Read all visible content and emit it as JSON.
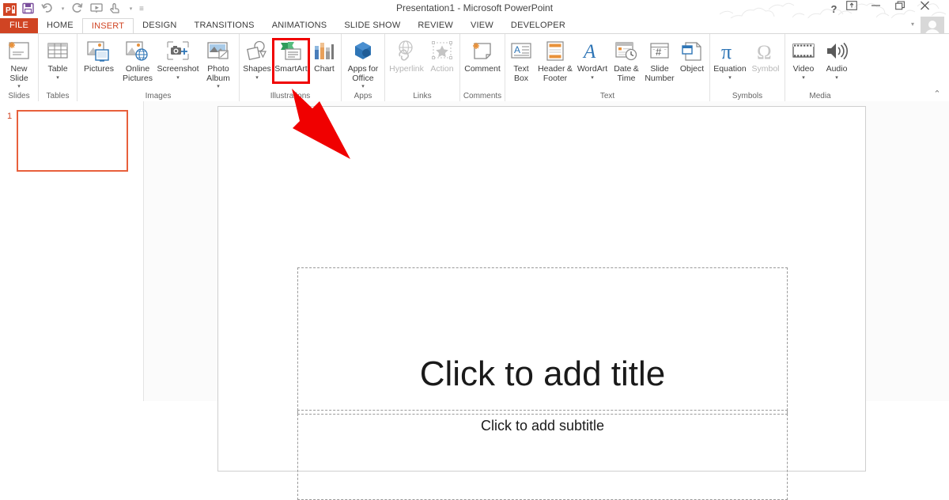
{
  "window": {
    "title": "Presentation1 - Microsoft PowerPoint",
    "logo_text": "P",
    "controls": {
      "help": "?",
      "ribbon_display": "ribbon-display-options",
      "minimize": "minimize",
      "restore": "restore",
      "close": "close"
    }
  },
  "quick_access": {
    "items": [
      {
        "name": "save-icon",
        "glyph": "💾"
      },
      {
        "name": "undo-icon",
        "glyph": "↶"
      },
      {
        "name": "redo-icon",
        "glyph": "↻"
      },
      {
        "name": "start-presentation-icon",
        "glyph": "▷"
      },
      {
        "name": "touch-mode-icon",
        "glyph": "☝"
      }
    ],
    "more_glyph": "≡",
    "caret_glyph": "▾"
  },
  "tabs": {
    "file": "FILE",
    "items": [
      {
        "label": "HOME",
        "active": false
      },
      {
        "label": "INSERT",
        "active": true
      },
      {
        "label": "DESIGN",
        "active": false
      },
      {
        "label": "TRANSITIONS",
        "active": false
      },
      {
        "label": "ANIMATIONS",
        "active": false
      },
      {
        "label": "SLIDE SHOW",
        "active": false
      },
      {
        "label": "REVIEW",
        "active": false
      },
      {
        "label": "VIEW",
        "active": false
      },
      {
        "label": "DEVELOPER",
        "active": false
      }
    ]
  },
  "ribbon": {
    "collapse_glyph": "⌃",
    "groups": [
      {
        "label": "Slides",
        "buttons": [
          {
            "name": "new-slide-button",
            "label": "New Slide",
            "caret": true,
            "disabled": false
          }
        ]
      },
      {
        "label": "Tables",
        "buttons": [
          {
            "name": "table-button",
            "label": "Table",
            "caret": true,
            "disabled": false
          }
        ]
      },
      {
        "label": "Images",
        "buttons": [
          {
            "name": "pictures-button",
            "label": "Pictures",
            "caret": false,
            "disabled": false
          },
          {
            "name": "online-pictures-button",
            "label": "Online Pictures",
            "caret": false,
            "disabled": false
          },
          {
            "name": "screenshot-button",
            "label": "Screenshot",
            "caret": true,
            "disabled": false
          },
          {
            "name": "photo-album-button",
            "label": "Photo Album",
            "caret": true,
            "disabled": false
          }
        ]
      },
      {
        "label": "Illustrations",
        "buttons": [
          {
            "name": "shapes-button",
            "label": "Shapes",
            "caret": true,
            "disabled": false
          },
          {
            "name": "smartart-button",
            "label": "SmartArt",
            "caret": false,
            "disabled": false
          },
          {
            "name": "chart-button",
            "label": "Chart",
            "caret": false,
            "disabled": false
          }
        ]
      },
      {
        "label": "Apps",
        "buttons": [
          {
            "name": "apps-for-office-button",
            "label": "Apps for Office",
            "caret": true,
            "disabled": false
          }
        ]
      },
      {
        "label": "Links",
        "buttons": [
          {
            "name": "hyperlink-button",
            "label": "Hyperlink",
            "caret": false,
            "disabled": true
          },
          {
            "name": "action-button",
            "label": "Action",
            "caret": false,
            "disabled": true
          }
        ]
      },
      {
        "label": "Comments",
        "buttons": [
          {
            "name": "comment-button",
            "label": "Comment",
            "caret": false,
            "disabled": false
          }
        ]
      },
      {
        "label": "Text",
        "buttons": [
          {
            "name": "text-box-button",
            "label": "Text Box",
            "caret": false,
            "disabled": false
          },
          {
            "name": "header-footer-button",
            "label": "Header & Footer",
            "caret": false,
            "disabled": false
          },
          {
            "name": "wordart-button",
            "label": "WordArt",
            "caret": true,
            "disabled": false
          },
          {
            "name": "date-time-button",
            "label": "Date & Time",
            "caret": false,
            "disabled": false
          },
          {
            "name": "slide-number-button",
            "label": "Slide Number",
            "caret": false,
            "disabled": false
          },
          {
            "name": "object-button",
            "label": "Object",
            "caret": false,
            "disabled": false
          }
        ]
      },
      {
        "label": "Symbols",
        "buttons": [
          {
            "name": "equation-button",
            "label": "Equation",
            "caret": true,
            "disabled": false
          },
          {
            "name": "symbol-button",
            "label": "Symbol",
            "caret": false,
            "disabled": true
          }
        ]
      },
      {
        "label": "Media",
        "buttons": [
          {
            "name": "video-button",
            "label": "Video",
            "caret": true,
            "disabled": false
          },
          {
            "name": "audio-button",
            "label": "Audio",
            "caret": true,
            "disabled": false
          }
        ]
      }
    ]
  },
  "slides_pane": {
    "slides": [
      {
        "number": "1",
        "selected": true
      }
    ]
  },
  "slide": {
    "title_placeholder": "Click to add title",
    "subtitle_placeholder": "Click to add subtitle"
  },
  "annotation": {
    "highlight_target": "SmartArt",
    "highlight_color": "#f00000",
    "arrow_color": "#f00000"
  }
}
